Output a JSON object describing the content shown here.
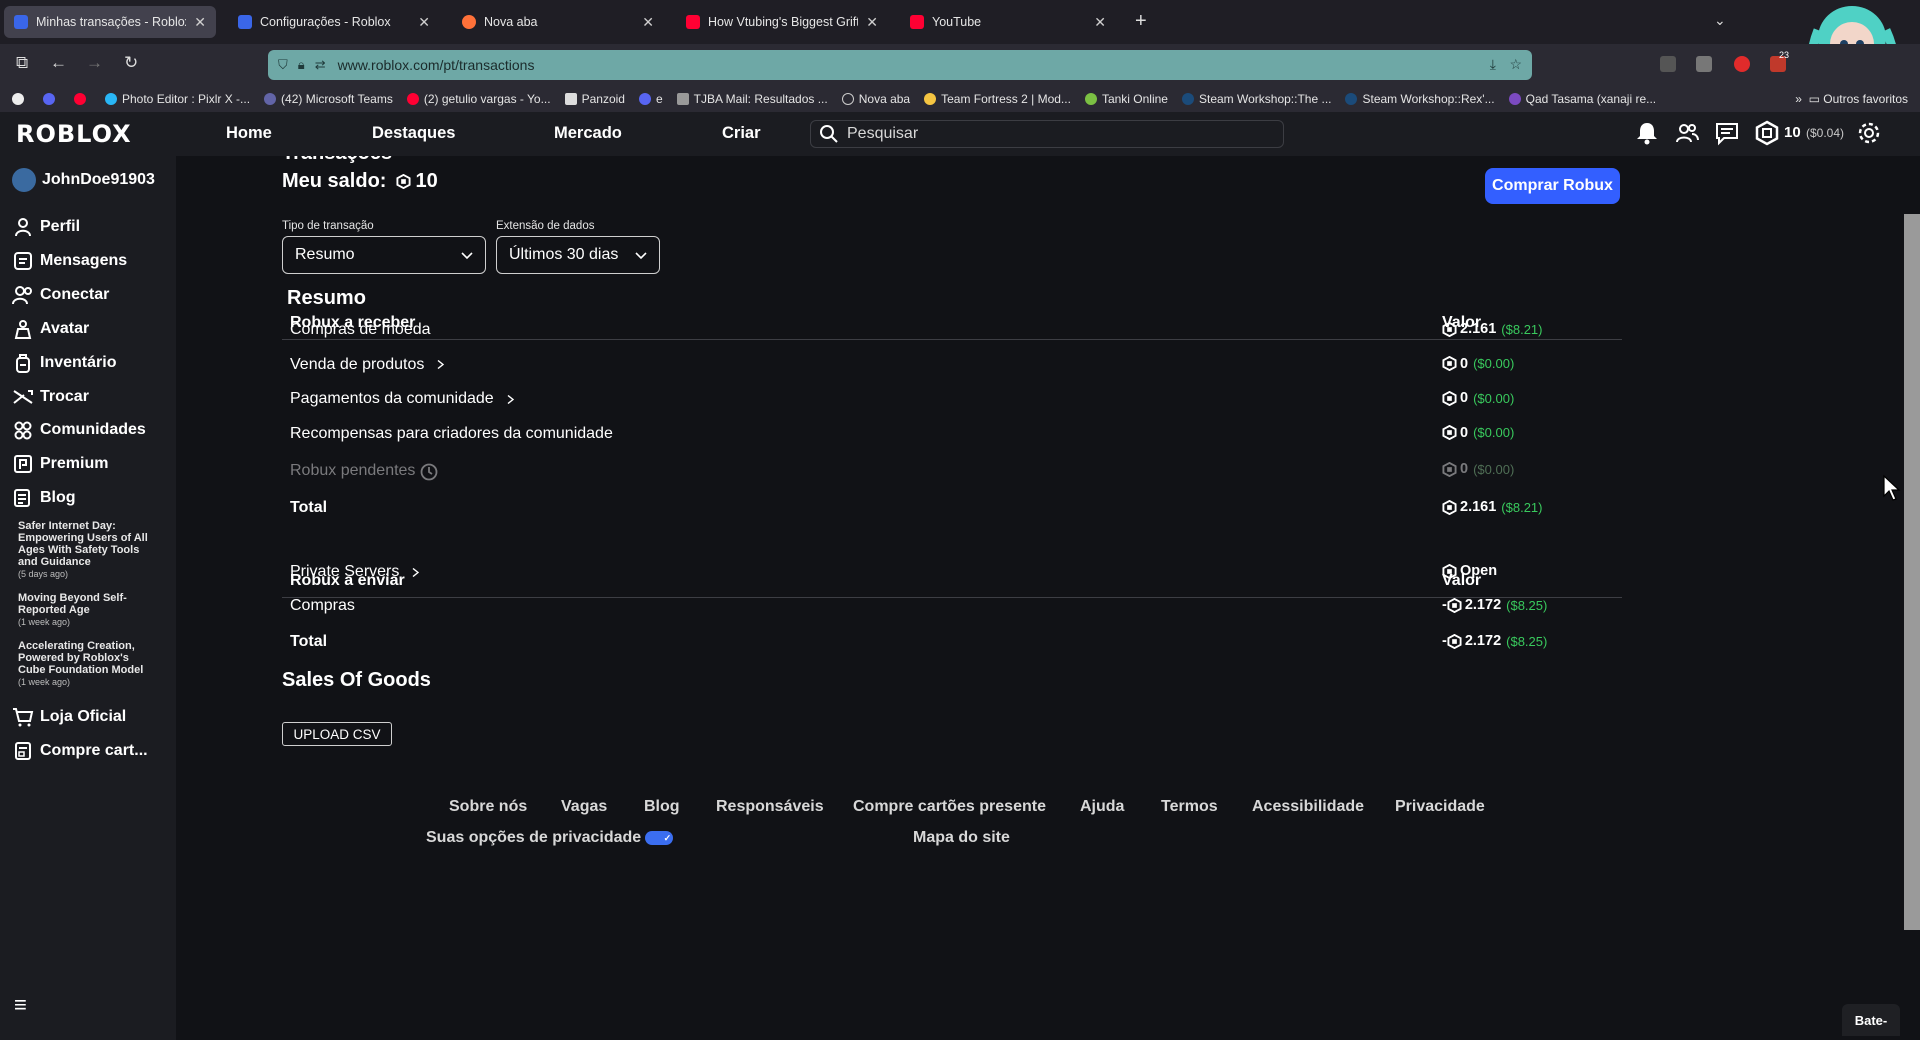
{
  "browser": {
    "tabs": [
      {
        "title": "Minhas transações - Roblox",
        "favicon": "roblox"
      },
      {
        "title": "Configurações - Roblox",
        "favicon": "roblox"
      },
      {
        "title": "Nova aba",
        "favicon": "firefox"
      },
      {
        "title": "How Vtubing's Biggest Grifter g",
        "favicon": "youtube"
      },
      {
        "title": "YouTube",
        "favicon": "youtube"
      }
    ],
    "url": "www.roblox.com/pt/transactions",
    "bookmarks": [
      "Photo Editor : Pixlr X -...",
      "(42) Microsoft Teams",
      "(2) getulio vargas - Yo...",
      "Panzoid",
      "e",
      "TJBA Mail: Resultados ...",
      "Nova aba",
      "Team Fortress 2 | Mod...",
      "Tanki Online",
      "Steam Workshop::The ...",
      "Steam Workshop::Rex'...",
      "Qad Tasama (xanaji re..."
    ],
    "other_bookmarks": "Outros favoritos",
    "ext_badge": "23"
  },
  "topnav": {
    "logo": "ROBLOX",
    "links": [
      "Home",
      "Destaques",
      "Mercado",
      "Criar"
    ],
    "search_placeholder": "Pesquisar",
    "robux": "10",
    "robux_usd": "($0.04)"
  },
  "sidebar": {
    "username": "JohnDoe91903",
    "items": [
      "Perfil",
      "Mensagens",
      "Conectar",
      "Avatar",
      "Inventário",
      "Trocar",
      "Comunidades",
      "Premium",
      "Blog"
    ],
    "news": [
      {
        "title": "Safer Internet Day: Empowering Users of All Ages With Safety Tools and Guidance",
        "ago": "(5 days ago)"
      },
      {
        "title": "Moving Beyond Self-Reported Age",
        "ago": "(1 week ago)"
      },
      {
        "title": "Accelerating Creation, Powered by Roblox's Cube Foundation Model",
        "ago": "(1 week ago)"
      }
    ],
    "bottom_items": [
      "Loja Oficial",
      "Compre cart..."
    ]
  },
  "main": {
    "cut_title": "Transações",
    "balance_label": "Meu saldo:",
    "balance_value": "10",
    "buy_button": "Comprar Robux",
    "filter_type_label": "Tipo de transação",
    "filter_type_value": "Resumo",
    "filter_range_label": "Extensão de dados",
    "filter_range_value": "Últimos 30 dias",
    "section_title": "Resumo",
    "receive_header": "Robux a receber",
    "value_header": "Valor",
    "receive_rows": [
      {
        "label": "Compras de moeda",
        "amount": "2.161",
        "usd": "($8.21)",
        "expandable": false
      },
      {
        "label": "Venda de produtos",
        "amount": "0",
        "usd": "($0.00)",
        "expandable": true
      },
      {
        "label": "Pagamentos da comunidade",
        "amount": "0",
        "usd": "($0.00)",
        "expandable": true
      },
      {
        "label": "Recompensas para criadores da comunidade",
        "amount": "0",
        "usd": "($0.00)",
        "expandable": false
      }
    ],
    "pending": {
      "label": "Robux pendentes",
      "amount": "0",
      "usd": "($0.00)"
    },
    "receive_total": {
      "label": "Total",
      "amount": "2.161",
      "usd": "($8.21)"
    },
    "send_header": "Robux a enviar",
    "send_rows": [
      {
        "label": "Private Servers",
        "amount": "Open",
        "usd": "",
        "expandable": true,
        "neg": false
      },
      {
        "label": "Compras",
        "amount": "2.172",
        "usd": "($8.25)",
        "expandable": false,
        "neg": true
      }
    ],
    "send_total": {
      "label": "Total",
      "amount": "2.172",
      "usd": "($8.25)"
    },
    "sales_title": "Sales Of Goods",
    "upload_button": "UPLOAD CSV"
  },
  "footer": {
    "links": [
      "Sobre nós",
      "Vagas",
      "Blog",
      "Responsáveis",
      "Compre cartões presente",
      "Ajuda",
      "Termos",
      "Acessibilidade",
      "Privacidade"
    ],
    "privacy_choices": "Suas opções de privacidade",
    "sitemap": "Mapa do site"
  },
  "chat": "Bate-",
  "colors": {
    "accent": "#335fff",
    "usd_green": "#39c95d",
    "background": "#111216",
    "panel": "#1b1c21"
  }
}
